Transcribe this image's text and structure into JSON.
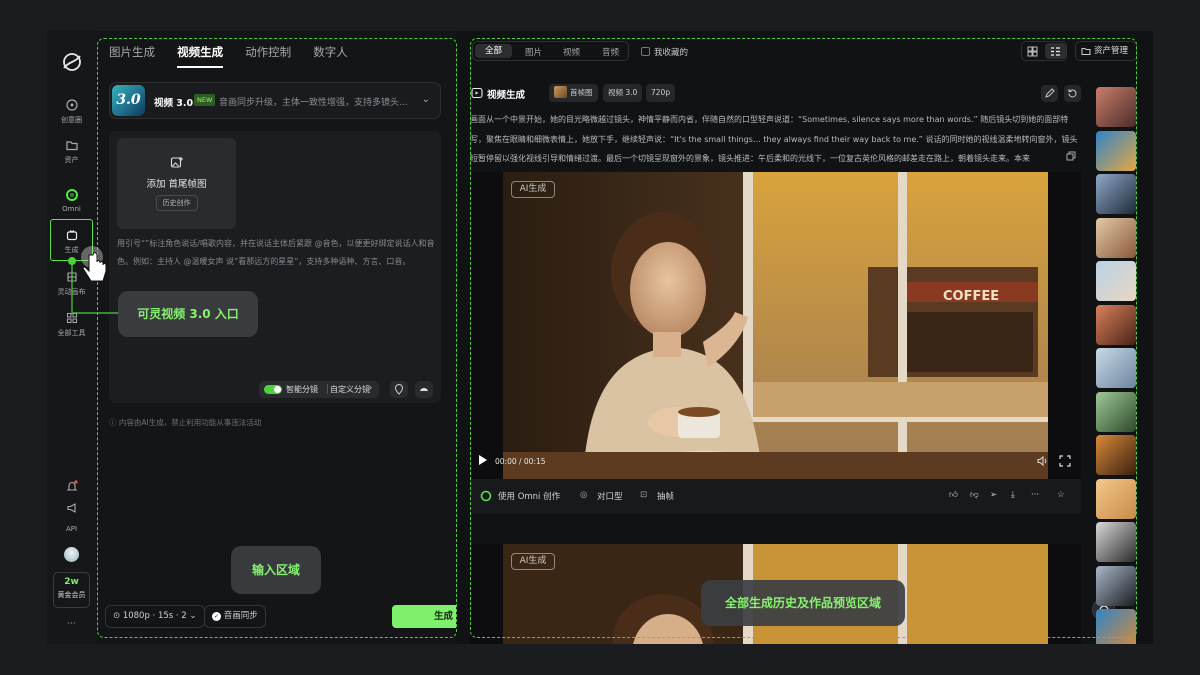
{
  "rail": {
    "items": [
      {
        "label": "创意圈",
        "icon": "compass-icon"
      },
      {
        "label": "资产",
        "icon": "folder-icon"
      },
      {
        "label": "Omni",
        "icon": "omni-icon"
      },
      {
        "label": "生成",
        "icon": "sparkle-box-icon"
      },
      {
        "label": "灵动画布",
        "icon": "canvas-icon"
      },
      {
        "label": "全部工具",
        "icon": "grid-icon"
      }
    ],
    "api_label": "API",
    "vip": {
      "count": "2w",
      "label": "黄金会员"
    },
    "more": "···"
  },
  "left": {
    "tabs": [
      "图片生成",
      "视频生成",
      "动作控制",
      "数字人"
    ],
    "active_tab": "视频生成",
    "model": {
      "logo": "3.0",
      "name": "视频 3.0",
      "badge": "NEW",
      "desc": "音画同步升级，主体一致性增强，支持多镜头..."
    },
    "upload": {
      "label": "添加 首尾帧图",
      "history": "历史创作"
    },
    "hint": "用引号“”标注角色说话/唱歌内容，并在说话主体后紧跟 @音色，以便更好绑定说话人和音色。例如：主持人 @温暖女声 说“看那远方的星星”，支持多种语种、方言、口音。",
    "smart_split": "智能分镜",
    "custom_split": "自定义分镜",
    "notice": "内容由AI生成，禁止利用功能从事违法活动",
    "settings": "1080p · 15s · 2",
    "audio_sync": "音画同步",
    "generate": "生成"
  },
  "content": {
    "filters": [
      "全部",
      "图片",
      "视频",
      "音频"
    ],
    "active_filter": "全部",
    "favorites": "我收藏的",
    "asset_mgmt": "资产管理",
    "card": {
      "title": "视频生成",
      "chips": [
        "首帧图",
        "视频 3.0",
        "720p"
      ],
      "prompt": "画面从一个中景开始，她的目光略微越过镜头，神情平静而内省，伴随自然的口型轻声说道：“Sometimes, silence says more than words.” 随后镜头切到她的面部特写，聚焦在眼睛和细微表情上，她放下手，继续轻声说：“It's the small things… they always find their way back to me.” 说话的同时她的视线温柔地转向窗外，镜头短暂停留以强化视线引导和情绪过渡。最后一个切镜呈现窗外的景象，镜头推进：午后柔和的光线下，一位复古英伦风格的邮差走在路上，朝着镜头走来。本来",
      "ai_tag": "AI生成",
      "time": "00:00 / 00:15",
      "sign": "COFFEE",
      "actions": {
        "omni": "使用 Omni 创作",
        "lipsync": "对口型",
        "frames": "抽帧"
      }
    }
  },
  "annotations": {
    "entry": "可灵视频 3.0 入口",
    "input": "输入区域",
    "history": "全部生成历史及作品预览区域"
  },
  "colors": {
    "accent": "#7ef06b",
    "dash": "#4fcf3e",
    "bg": "#111214"
  }
}
